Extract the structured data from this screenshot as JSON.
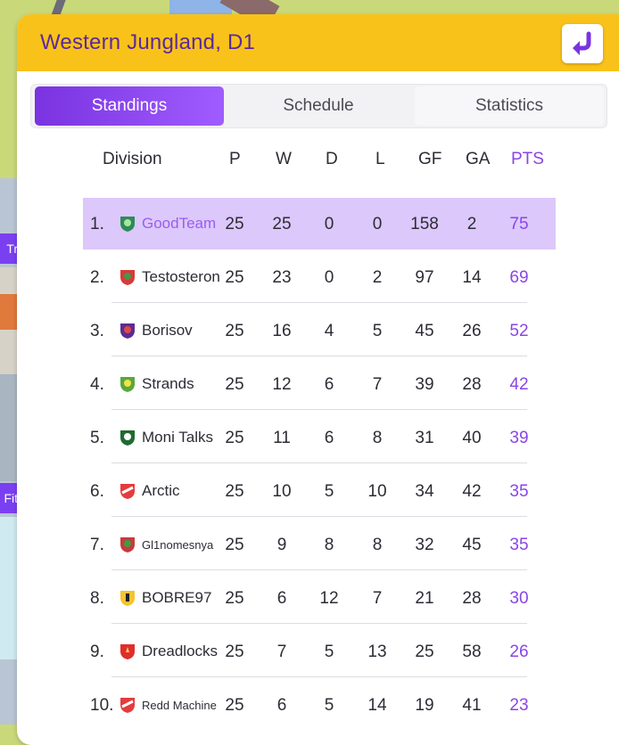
{
  "header": {
    "title": "Western Jungland, D1",
    "back_icon": "return-arrow-icon"
  },
  "background_tags": [
    "Tr",
    "Fit"
  ],
  "tabs": [
    {
      "label": "Standings",
      "active": true
    },
    {
      "label": "Schedule",
      "active": false
    },
    {
      "label": "Statistics",
      "active": false
    }
  ],
  "table": {
    "columns": [
      "Division",
      "P",
      "W",
      "D",
      "L",
      "GF",
      "GA",
      "PTS"
    ],
    "rows": [
      {
        "rank": "1.",
        "team": "GoodTeam",
        "crest": "crest-green-icon",
        "p": "25",
        "w": "25",
        "d": "0",
        "l": "0",
        "gf": "158",
        "ga": "2",
        "pts": "75"
      },
      {
        "rank": "2.",
        "team": "Testosteron",
        "crest": "crest-red-green-icon",
        "p": "25",
        "w": "23",
        "d": "0",
        "l": "2",
        "gf": "97",
        "ga": "14",
        "pts": "69"
      },
      {
        "rank": "3.",
        "team": "Borisov",
        "crest": "crest-purple-red-icon",
        "p": "25",
        "w": "16",
        "d": "4",
        "l": "5",
        "gf": "45",
        "ga": "26",
        "pts": "52"
      },
      {
        "rank": "4.",
        "team": "Strands",
        "crest": "crest-green-yellow-icon",
        "p": "25",
        "w": "12",
        "d": "6",
        "l": "7",
        "gf": "39",
        "ga": "28",
        "pts": "42"
      },
      {
        "rank": "5.",
        "team": "Moni Talks",
        "crest": "crest-darkgreen-icon",
        "p": "25",
        "w": "11",
        "d": "6",
        "l": "8",
        "gf": "31",
        "ga": "40",
        "pts": "39"
      },
      {
        "rank": "6.",
        "team": "Arctic",
        "crest": "crest-red-white-icon",
        "p": "25",
        "w": "10",
        "d": "5",
        "l": "10",
        "gf": "34",
        "ga": "42",
        "pts": "35"
      },
      {
        "rank": "7.",
        "team": "Gl1nomesnya",
        "crest": "crest-red-green-icon",
        "p": "25",
        "w": "9",
        "d": "8",
        "l": "8",
        "gf": "32",
        "ga": "45",
        "pts": "35"
      },
      {
        "rank": "8.",
        "team": "BOBRE97",
        "crest": "crest-yellow-black-icon",
        "p": "25",
        "w": "6",
        "d": "12",
        "l": "7",
        "gf": "21",
        "ga": "28",
        "pts": "30"
      },
      {
        "rank": "9.",
        "team": "Dreadlocks",
        "crest": "crest-red-yellow-icon",
        "p": "25",
        "w": "7",
        "d": "5",
        "l": "13",
        "gf": "25",
        "ga": "58",
        "pts": "26"
      },
      {
        "rank": "10.",
        "team": "Redd Machine",
        "crest": "crest-red-white-icon",
        "p": "25",
        "w": "6",
        "d": "5",
        "l": "14",
        "gf": "19",
        "ga": "41",
        "pts": "23"
      }
    ]
  },
  "colors": {
    "accent": "#8a45e6",
    "header": "#f9c21a",
    "highlight": "#dcc8fb",
    "title": "#5b2a9d"
  }
}
